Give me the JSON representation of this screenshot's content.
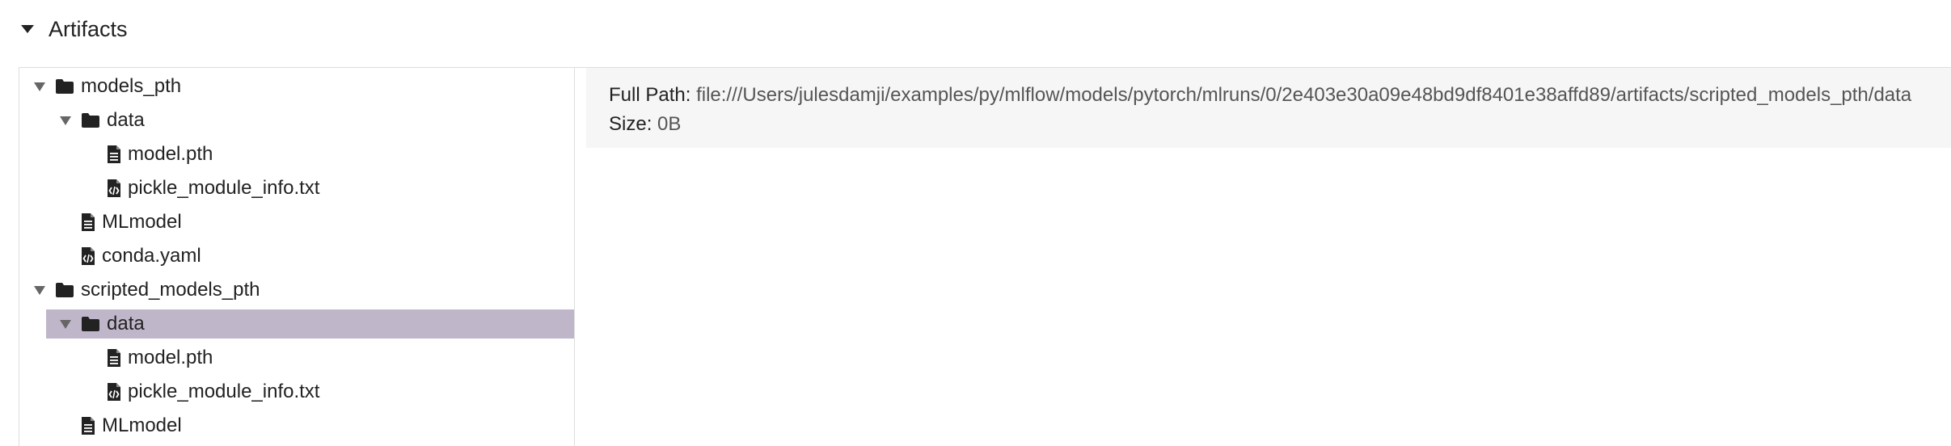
{
  "section": {
    "title": "Artifacts",
    "toggle_icon": "caret-down-icon"
  },
  "tree": {
    "nodes": [
      {
        "label": "models_pth",
        "type": "folder",
        "expanded": true,
        "depth": 0,
        "selected": false
      },
      {
        "label": "data",
        "type": "folder",
        "expanded": true,
        "depth": 1,
        "selected": false
      },
      {
        "label": "model.pth",
        "type": "file",
        "depth": 2,
        "selected": false
      },
      {
        "label": "pickle_module_info.txt",
        "type": "code-file",
        "depth": 2,
        "selected": false
      },
      {
        "label": "MLmodel",
        "type": "file",
        "depth": 1,
        "selected": false
      },
      {
        "label": "conda.yaml",
        "type": "code-file",
        "depth": 1,
        "selected": false
      },
      {
        "label": "scripted_models_pth",
        "type": "folder",
        "expanded": true,
        "depth": 0,
        "selected": false
      },
      {
        "label": "data",
        "type": "folder",
        "expanded": true,
        "depth": 1,
        "selected": true
      },
      {
        "label": "model.pth",
        "type": "file",
        "depth": 2,
        "selected": false
      },
      {
        "label": "pickle_module_info.txt",
        "type": "code-file",
        "depth": 2,
        "selected": false
      },
      {
        "label": "MLmodel",
        "type": "file",
        "depth": 1,
        "selected": false
      }
    ],
    "selected_color": "#c0b6ca"
  },
  "detail": {
    "full_path_label": "Full Path:",
    "full_path_value": "file:///Users/julesdamji/examples/py/mlflow/models/pytorch/mlruns/0/2e403e30a09e48bd9df8401e38affd89/artifacts/scripted_models_pth/data",
    "size_label": "Size:",
    "size_value": "0B"
  }
}
